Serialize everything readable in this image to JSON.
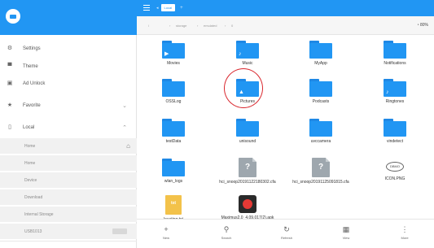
{
  "sidebar": {
    "items": [
      {
        "label": "Settings",
        "icon": "gear-icon"
      },
      {
        "label": "Theme",
        "icon": "paint-roller-icon"
      },
      {
        "label": "Ad Unlock",
        "icon": "lock-icon"
      },
      {
        "label": "Favorite",
        "icon": "star-icon"
      },
      {
        "label": "Local",
        "icon": "phone-icon"
      }
    ],
    "local_items": [
      "Home",
      "Home",
      "Device",
      "Download",
      "Internal Storage",
      "USB1013"
    ]
  },
  "topbar": {
    "tab_label": "Local"
  },
  "path": {
    "segments": [
      "/",
      "storage",
      "emulated",
      "0"
    ],
    "storage_label": "80%"
  },
  "files": [
    {
      "name": "Movies",
      "type": "folder",
      "glyph": "▶"
    },
    {
      "name": "Music",
      "type": "folder",
      "glyph": "♪"
    },
    {
      "name": "MyApp",
      "type": "folder",
      "glyph": ""
    },
    {
      "name": "Notifications",
      "type": "folder",
      "glyph": ""
    },
    {
      "name": "OSSLog",
      "type": "folder",
      "glyph": ""
    },
    {
      "name": "Pictures",
      "type": "folder",
      "glyph": "▲"
    },
    {
      "name": "Podcasts",
      "type": "folder",
      "glyph": ""
    },
    {
      "name": "Ringtones",
      "type": "folder",
      "glyph": "♪"
    },
    {
      "name": "testData",
      "type": "folder",
      "glyph": ""
    },
    {
      "name": "unisound",
      "type": "folder",
      "glyph": ""
    },
    {
      "name": "uvccamera",
      "type": "folder",
      "glyph": ""
    },
    {
      "name": "vindetect",
      "type": "folder",
      "glyph": ""
    },
    {
      "name": "wlan_logs",
      "type": "folder",
      "glyph": ""
    },
    {
      "name": "hci_snoop20191122180302.cfa",
      "type": "unknown",
      "glyph": "?"
    },
    {
      "name": "hci_snoop20191125091815.cfa",
      "type": "unknown",
      "glyph": "?"
    },
    {
      "name": "ICON.PNG",
      "type": "image",
      "glyph": "DBMO"
    },
    {
      "name": "locating.txt",
      "type": "text",
      "glyph": "txt"
    },
    {
      "name": "Maximus2.0_4.09.017(2).apk",
      "type": "apk",
      "glyph": ""
    }
  ],
  "bottombar": [
    {
      "label": "New",
      "icon": "+"
    },
    {
      "label": "Search",
      "icon": "⚲"
    },
    {
      "label": "Refresh",
      "icon": "↻"
    },
    {
      "label": "View",
      "icon": "▦"
    },
    {
      "label": "More",
      "icon": "⋮"
    }
  ],
  "colors": {
    "accent": "#2196f3",
    "highlight": "#d9272e"
  }
}
